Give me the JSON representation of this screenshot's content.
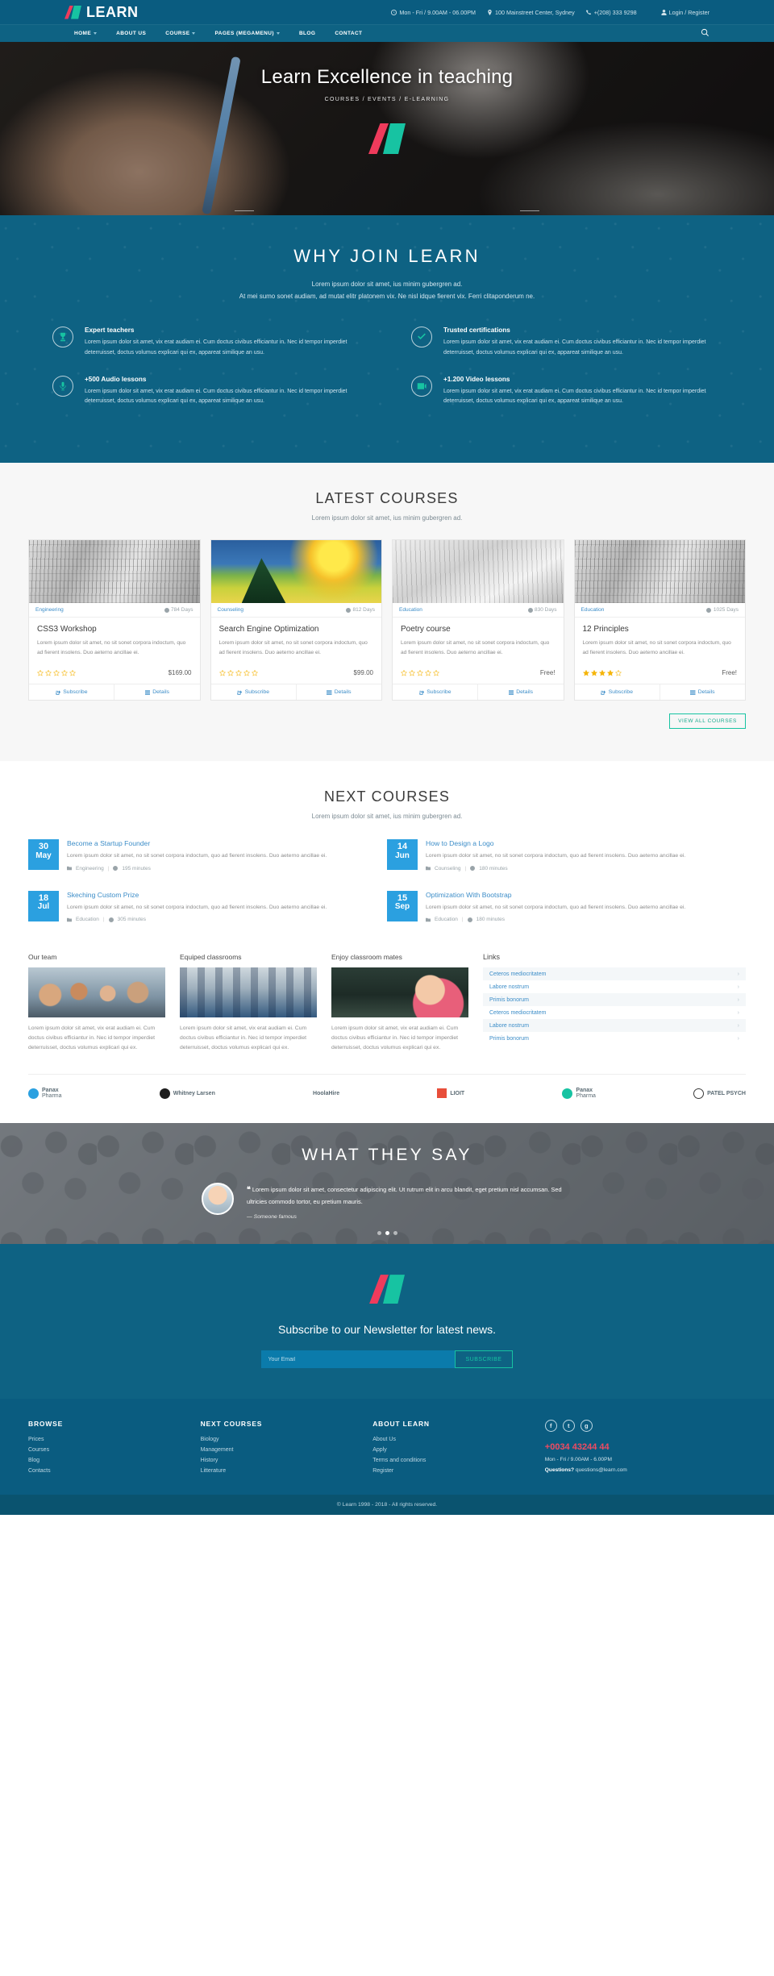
{
  "brand": {
    "name": "LEARN"
  },
  "topbar": {
    "hours": "Mon - Fri / 9.00AM - 06.00PM",
    "address": "100 Mainstreet Center, Sydney",
    "phone": "+(208) 333 9298",
    "login": "Login / Register"
  },
  "nav": {
    "items": [
      {
        "label": "HOME",
        "caret": true
      },
      {
        "label": "ABOUT US",
        "caret": false
      },
      {
        "label": "COURSE",
        "caret": true
      },
      {
        "label": "PAGES (MEGAMENU)",
        "caret": true
      },
      {
        "label": "BLOG",
        "caret": false
      },
      {
        "label": "CONTACT",
        "caret": false
      }
    ],
    "search_icon": "search-icon"
  },
  "hero": {
    "title": "Learn Excellence in teaching",
    "subtitle": "COURSES / EVENTS / E-LEARNING"
  },
  "why": {
    "title": "WHY JOIN LEARN",
    "lead1": "Lorem ipsum dolor sit amet, ius minim gubergren ad.",
    "lead2": "At mei sumo sonet audiam, ad mutat elitr platonem vix. Ne nisl idque fierent vix. Ferri clitaponderum ne.",
    "features": [
      {
        "icon": "trophy-icon",
        "title": "Expert teachers",
        "text": "Lorem ipsum dolor sit amet, vix erat audiam ei. Cum doctus civibus efficiantur in. Nec id tempor imperdiet deterruisset, doctus volumus explicari qui ex, appareat similique an usu."
      },
      {
        "icon": "check-icon",
        "title": "Trusted certifications",
        "text": "Lorem ipsum dolor sit amet, vix erat audiam ei. Cum doctus civibus efficiantur in. Nec id tempor imperdiet deterruisset, doctus volumus explicari qui ex, appareat similique an usu."
      },
      {
        "icon": "microphone-icon",
        "title": "+500 Audio lessons",
        "text": "Lorem ipsum dolor sit amet, vix erat audiam ei. Cum doctus civibus efficiantur in. Nec id tempor imperdiet deterruisset, doctus volumus explicari qui ex, appareat similique an usu."
      },
      {
        "icon": "video-icon",
        "title": "+1.200 Video lessons",
        "text": "Lorem ipsum dolor sit amet, vix erat audiam ei. Cum doctus civibus efficiantur in. Nec id tempor imperdiet deterruisset, doctus volumus explicari qui ex, appareat similique an usu."
      }
    ]
  },
  "latest": {
    "title": "LATEST COURSES",
    "subtitle": "Lorem ipsum dolor sit amet, ius minim gubergren ad.",
    "view_all": "VIEW ALL COURSES",
    "subscribe_label": "Subscribe",
    "details_label": "Details",
    "courses": [
      {
        "category": "Engineering",
        "days": "784 Days",
        "title": "CSS3 Workshop",
        "desc": "Lorem ipsum dolor sit amet, no sit sonet corpora indoctum, quo ad fierent insolens. Duo aeterno ancillae ei.",
        "rating": 0,
        "price": "$169.00",
        "image": "newsprint"
      },
      {
        "category": "Counseling",
        "days": "812 Days",
        "title": "Search Engine Optimization",
        "desc": "Lorem ipsum dolor sit amet, no sit sonet corpora indoctum, quo ad fierent insolens. Duo aeterno ancillae ei.",
        "rating": 0,
        "price": "$99.00",
        "image": "paint"
      },
      {
        "category": "Education",
        "days": "830 Days",
        "title": "Poetry course",
        "desc": "Lorem ipsum dolor sit amet, no sit sonet corpora indoctum, quo ad fierent insolens. Duo aeterno ancillae ei.",
        "rating": 0,
        "price": "Free!",
        "image": "pencil"
      },
      {
        "category": "Education",
        "days": "1025 Days",
        "title": "12 Principles",
        "desc": "Lorem ipsum dolor sit amet, no sit sonet corpora indoctum, quo ad fierent insolens. Duo aeterno ancillae ei.",
        "rating": 4.5,
        "price": "Free!",
        "image": "newsprint"
      }
    ]
  },
  "next": {
    "title": "NEXT COURSES",
    "subtitle": "Lorem ipsum dolor sit amet, ius minim gubergren ad.",
    "items": [
      {
        "day": "30",
        "month": "May",
        "title": "Become a Startup Founder",
        "desc": "Lorem ipsum dolor sit amet, no sit sonet corpora indoctum, quo ad fierent insolens. Duo aeterno ancillae ei.",
        "category": "Engineering",
        "duration": "195 minutes"
      },
      {
        "day": "14",
        "month": "Jun",
        "title": "How to Design a Logo",
        "desc": "Lorem ipsum dolor sit amet, no sit sonet corpora indoctum, quo ad fierent insolens. Duo aeterno ancillae ei.",
        "category": "Counseling",
        "duration": "180 minutes"
      },
      {
        "day": "18",
        "month": "Jul",
        "title": "Skeching Custom Prize",
        "desc": "Lorem ipsum dolor sit amet, no sit sonet corpora indoctum, quo ad fierent insolens. Duo aeterno ancillae ei.",
        "category": "Education",
        "duration": "305 minutes"
      },
      {
        "day": "15",
        "month": "Sep",
        "title": "Optimization With Bootstrap",
        "desc": "Lorem ipsum dolor sit amet, no sit sonet corpora indoctum, quo ad fierent insolens. Duo aeterno ancillae ei.",
        "category": "Education",
        "duration": "180 minutes"
      }
    ]
  },
  "team": {
    "columns": [
      {
        "title": "Our team",
        "image": "team-photo",
        "text": "Lorem ipsum dolor sit amet, vix erat audiam ei. Cum doctus civibus efficiantur in. Nec id tempor imperdiet deterruisset, doctus volumus explicari qui ex."
      },
      {
        "title": "Equiped classrooms",
        "image": "classroom-photo",
        "text": "Lorem ipsum dolor sit amet, vix erat audiam ei. Cum doctus civibus efficiantur in. Nec id tempor imperdiet deterruisset, doctus volumus explicari qui ex."
      },
      {
        "title": "Enjoy classroom mates",
        "image": "student-photo",
        "text": "Lorem ipsum dolor sit amet, vix erat audiam ei. Cum doctus civibus efficiantur in. Nec id tempor imperdiet deterruisset, doctus volumus explicari qui ex."
      }
    ],
    "links_title": "Links",
    "links": [
      "Ceteros mediocritatem",
      "Labore nostrum",
      "Primis bonorum",
      "Ceteros mediocritatem",
      "Labore nostrum",
      "Primis bonorum"
    ]
  },
  "brands": [
    {
      "name": "Panax Pharma",
      "line1": "Panax",
      "line2": "Pharma",
      "mark": "dot-blue"
    },
    {
      "name": "Whitney Larsen",
      "line1": "Whitney Larsen",
      "line2": "",
      "mark": "dot-dark"
    },
    {
      "name": "HoolaHire",
      "line1": "HoolaHire",
      "line2": "",
      "mark": "text-blue"
    },
    {
      "name": "LIOIT",
      "line1": "LIOIT",
      "line2": "",
      "mark": "square-red"
    },
    {
      "name": "Panax Pharma",
      "line1": "Panax",
      "line2": "Pharma",
      "mark": "dot-green"
    },
    {
      "name": "Patel Psych",
      "line1": "PATEL PSYCH",
      "line2": "",
      "mark": "ring-dark"
    }
  ],
  "testimonials": {
    "title": "WHAT THEY SAY",
    "quote": "Lorem ipsum dolor sit amet, consectetur adipiscing elit. Ut rutrum elit in arcu blandit, eget pretium nisl accumsan. Sed ultricies commodo tortor, eu pretium mauris.",
    "author": "— Someone famous",
    "dots": 3,
    "active_dot": 2
  },
  "newsletter": {
    "heading": "Subscribe to our Newsletter for latest news.",
    "placeholder": "Your Email",
    "button": "SUBSCRIBE"
  },
  "footer": {
    "columns": [
      {
        "title": "BROWSE",
        "links": [
          "Prices",
          "Courses",
          "Blog",
          "Contacts"
        ]
      },
      {
        "title": "NEXT COURSES",
        "links": [
          "Biology",
          "Management",
          "History",
          "Litterature"
        ]
      },
      {
        "title": "ABOUT LEARN",
        "links": [
          "About Us",
          "Apply",
          "Terms and conditions",
          "Register"
        ]
      }
    ],
    "social": [
      {
        "icon": "facebook-icon",
        "glyph": "f"
      },
      {
        "icon": "twitter-icon",
        "glyph": "t"
      },
      {
        "icon": "google-plus-icon",
        "glyph": "g"
      }
    ],
    "phone": "+0034 43244 44",
    "hours": "Mon - Fri / 9.00AM - 6.00PM",
    "questions_label": "Questions?",
    "questions_email": "questions@learn.com",
    "copyright": "© Learn 1998 - 2018 - All rights reserved."
  }
}
